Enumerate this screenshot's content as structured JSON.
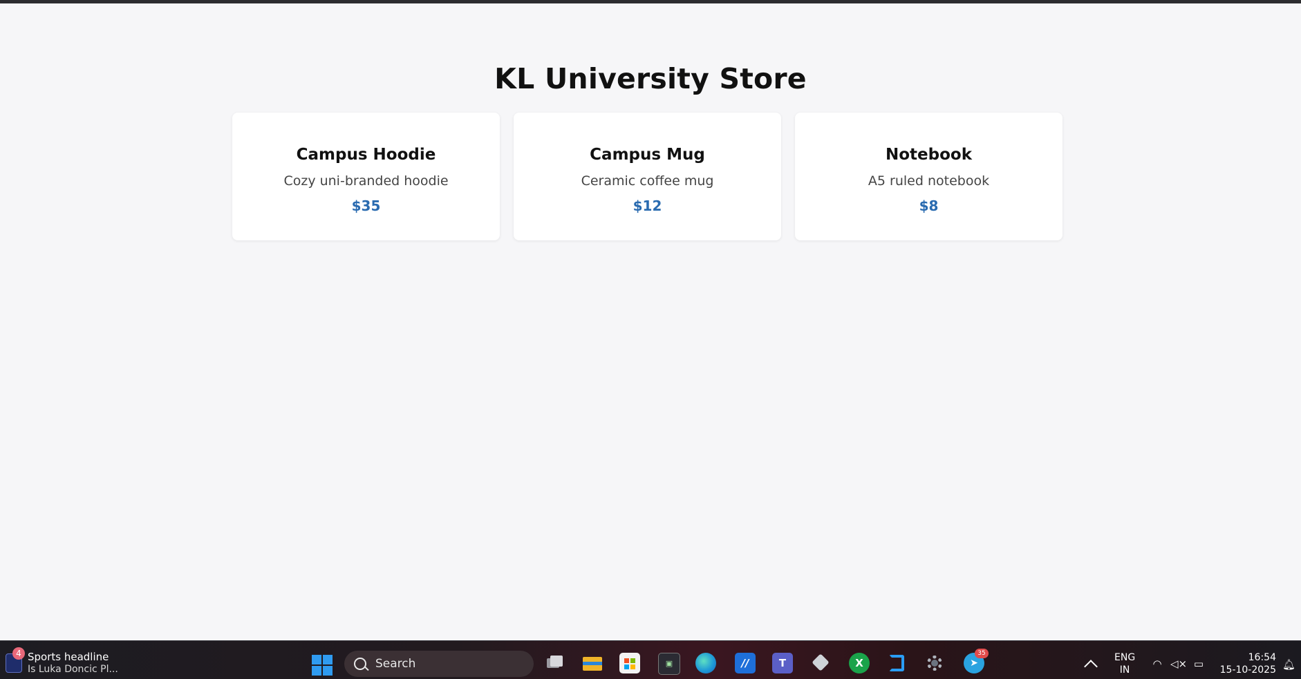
{
  "store": {
    "title": "KL University Store",
    "products": [
      {
        "name": "Campus Hoodie",
        "description": "Cozy uni-branded hoodie",
        "price": "$35"
      },
      {
        "name": "Campus Mug",
        "description": "Ceramic coffee mug",
        "price": "$12"
      },
      {
        "name": "Notebook",
        "description": "A5 ruled notebook",
        "price": "$8"
      }
    ],
    "colors": {
      "price": "#2a6bb0",
      "background": "#f6f6f8",
      "card": "#ffffff"
    }
  },
  "taskbar": {
    "news": {
      "badge": "4",
      "title": "Sports headline",
      "subtitle": "Is Luka Doncic Pl..."
    },
    "search": {
      "label": "Search"
    },
    "apps": [
      {
        "name": "task-view-icon"
      },
      {
        "name": "file-explorer-icon"
      },
      {
        "name": "microsoft-store-icon"
      },
      {
        "name": "dev-home-icon"
      },
      {
        "name": "edge-icon"
      },
      {
        "name": "authenticator-icon"
      },
      {
        "name": "teams-icon"
      },
      {
        "name": "unity-icon"
      },
      {
        "name": "xbox-icon"
      },
      {
        "name": "vscode-icon"
      },
      {
        "name": "settings-icon"
      },
      {
        "name": "telegram-icon",
        "badge": "35"
      }
    ],
    "tray": {
      "language_line1": "ENG",
      "language_line2": "IN",
      "time": "16:54",
      "date": "15-10-2025"
    }
  }
}
